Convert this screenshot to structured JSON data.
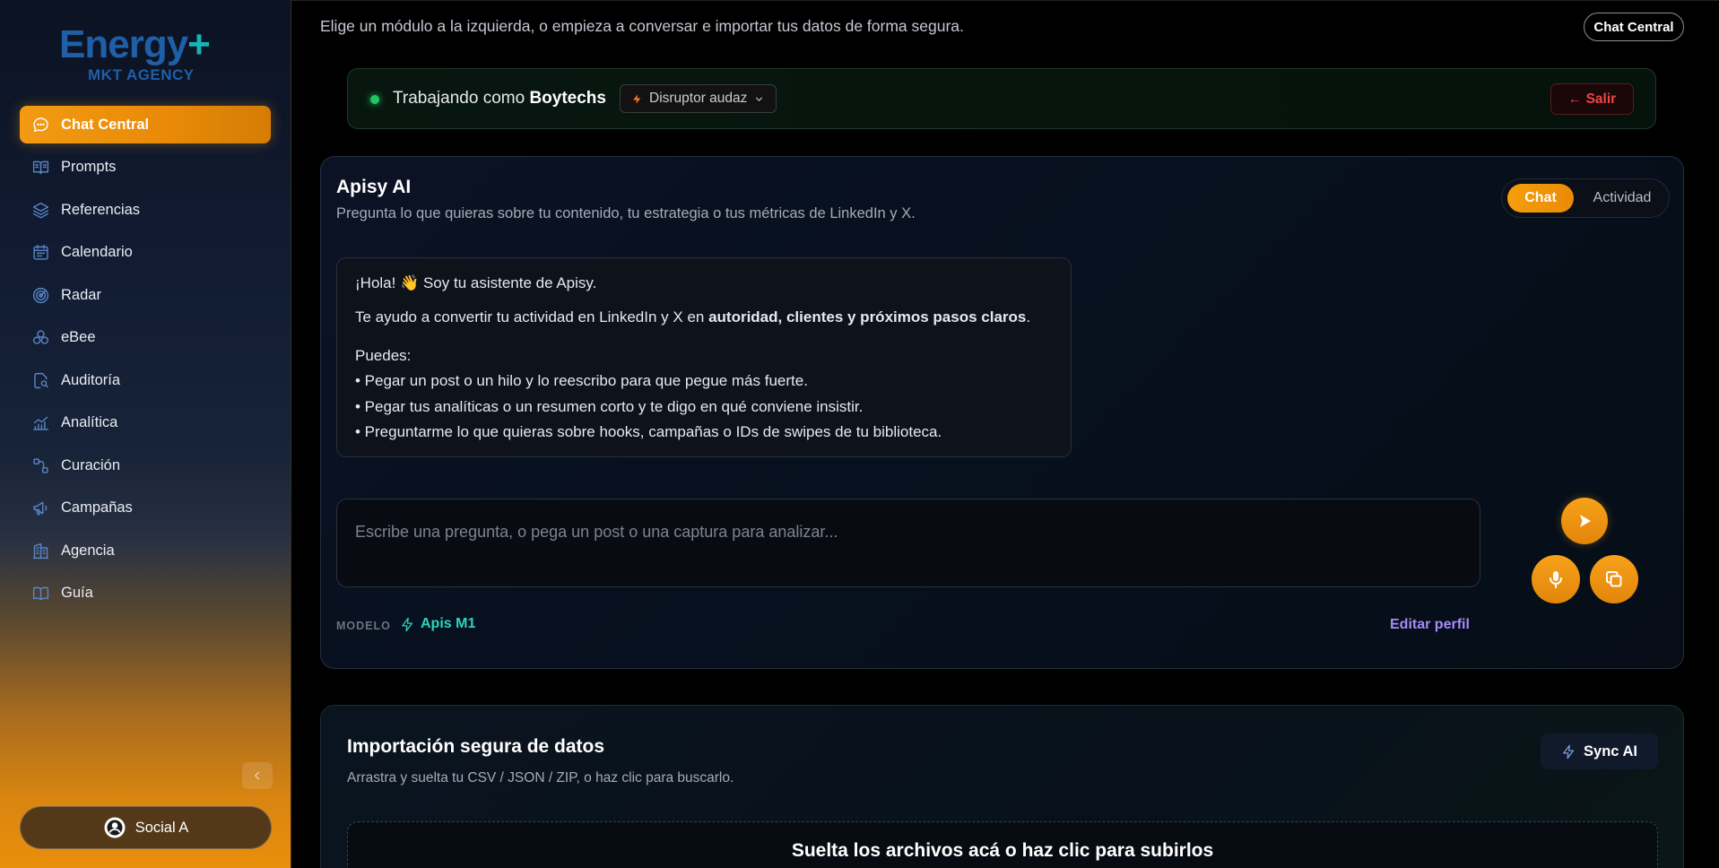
{
  "sidebar": {
    "logo": {
      "main": "Energy",
      "plus": "+",
      "sub": "MKT AGENCY"
    },
    "items": [
      {
        "label": "Chat Central",
        "icon": "chat-bubble-icon",
        "active": true
      },
      {
        "label": "Prompts",
        "icon": "book-open-icon"
      },
      {
        "label": "Referencias",
        "icon": "layers-icon"
      },
      {
        "label": "Calendario",
        "icon": "calendar-icon"
      },
      {
        "label": "Radar",
        "icon": "radar-icon"
      },
      {
        "label": "eBee",
        "icon": "hexagon-cluster-icon"
      },
      {
        "label": "Auditoría",
        "icon": "document-search-icon"
      },
      {
        "label": "Analítica",
        "icon": "chart-line-icon"
      },
      {
        "label": "Curación",
        "icon": "route-icon"
      },
      {
        "label": "Campañas",
        "icon": "megaphone-icon"
      },
      {
        "label": "Agencia",
        "icon": "building-icon"
      },
      {
        "label": "Guía",
        "icon": "book-icon"
      }
    ],
    "social_button": "Social A"
  },
  "header": {
    "subtitle": "Elige un módulo a la izquierda, o empieza a conversar e importar tus datos de forma segura.",
    "chip": "Chat Central"
  },
  "working": {
    "prefix": "Trabajando como",
    "user": "Boytechs",
    "persona": "Disruptor audaz",
    "exit": "← Salir"
  },
  "chat": {
    "title": "Apisy AI",
    "subtitle": "Pregunta lo que quieras sobre tu contenido, tu estrategia o tus métricas de LinkedIn y X.",
    "tabs": {
      "chat": "Chat",
      "activity": "Actividad"
    },
    "message": {
      "greeting": "¡Hola! 👋 Soy tu asistente de Apisy.",
      "line2_prefix": "Te ayudo a convertir tu actividad en LinkedIn y X en ",
      "line2_bold": "autoridad, clientes y próximos pasos claros",
      "line2_suffix": ".",
      "list_title": "Puedes:",
      "list": [
        "• Pegar un post o un hilo y lo reescribo para que pegue más fuerte.",
        "• Pegar tus analíticas o un resumen corto y te digo en qué conviene insistir.",
        "• Preguntarme lo que quieras sobre hooks, campañas o IDs de swipes de tu biblioteca."
      ]
    },
    "input_placeholder": "Escribe una pregunta, o pega un post o una captura para analizar...",
    "model_label": "MODELO",
    "model_value": "Apis M1",
    "edit_profile": "Editar perfil"
  },
  "import": {
    "title": "Importación segura de datos",
    "subtitle": "Arrastra y suelta tu CSV / JSON / ZIP, o haz clic para buscarlo.",
    "sync_button": "Sync AI",
    "dropzone": "Suelta los archivos acá o haz clic para subirlos"
  },
  "colors": {
    "accent": "#f59e0b",
    "status_online": "#22c55e",
    "model_teal": "#2dd4bf",
    "exit_red": "#ef4444",
    "link_purple": "#a78bfa"
  }
}
